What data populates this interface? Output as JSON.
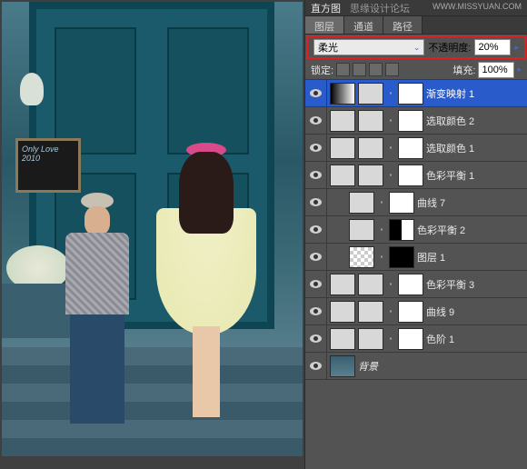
{
  "watermark_left": "思缘设计论坛",
  "watermark_right": "WWW.MISSYUAN.COM",
  "top_tab": "直方图",
  "panel_tabs": [
    "图层",
    "通道",
    "路径"
  ],
  "blend": {
    "mode": "柔光",
    "opacity_label": "不透明度:",
    "opacity_value": "20%"
  },
  "lock": {
    "label": "锁定:",
    "fill_label": "填充:",
    "fill_value": "100%"
  },
  "board_text": "Only Love 2010",
  "layers": [
    {
      "name": "渐变映射 1",
      "sel": true,
      "t1": "grad",
      "t2": "adj",
      "mask": "mask"
    },
    {
      "name": "选取颜色 2",
      "t1": "adj",
      "t2": "adj",
      "mask": "mask"
    },
    {
      "name": "选取颜色 1",
      "t1": "adj",
      "t2": "adj",
      "mask": "mask"
    },
    {
      "name": "色彩平衡 1",
      "t1": "adj",
      "t2": "adj",
      "mask": "mask"
    },
    {
      "name": "曲线 7",
      "indent": true,
      "t1": "adj",
      "mask": "mask"
    },
    {
      "name": "色彩平衡 2",
      "indent": true,
      "t1": "adj",
      "mask": "maskh"
    },
    {
      "name": "图层 1",
      "indent": true,
      "t1": "chk",
      "mask": "maskb"
    },
    {
      "name": "色彩平衡 3",
      "t1": "adj",
      "t2": "adj",
      "mask": "mask"
    },
    {
      "name": "曲线 9",
      "t1": "adj",
      "t2": "adj",
      "mask": "mask"
    },
    {
      "name": "色阶 1",
      "t1": "adj",
      "t2": "adj",
      "mask": "mask"
    },
    {
      "name": "背景",
      "t1": "bg",
      "italic": true
    }
  ]
}
